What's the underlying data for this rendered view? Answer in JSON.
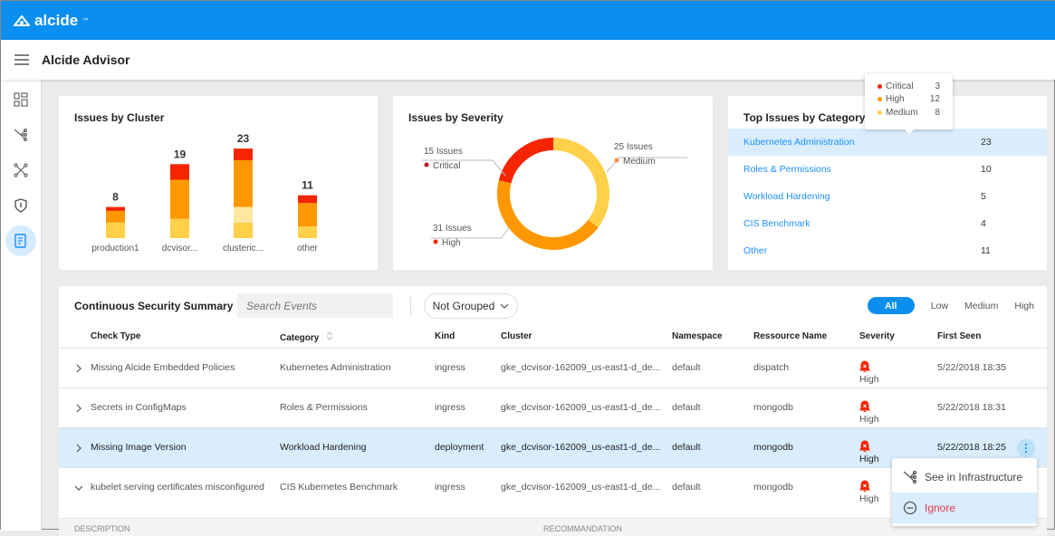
{
  "app": {
    "logo": "alcide",
    "logo_tm": "™",
    "title": "Alcide Advisor"
  },
  "sidebar": {
    "items": [
      {
        "icon": "dashboard-icon"
      },
      {
        "icon": "infrastructure-icon"
      },
      {
        "icon": "network-icon"
      },
      {
        "icon": "shield-icon"
      },
      {
        "icon": "report-icon",
        "active": true
      }
    ]
  },
  "colors": {
    "brand": "#0a8ff0",
    "critical": "#f52500",
    "high": "#ff9800",
    "medium": "#ffd04a",
    "low": "#ffe79f",
    "link": "#1e90ff"
  },
  "chart_data": [
    {
      "type": "bar",
      "stacked": true,
      "title": "Issues by Cluster",
      "categories": [
        "production1",
        "dcvisor...",
        "clusteric...",
        "other"
      ],
      "totals": [
        8,
        19,
        23,
        11
      ],
      "series": [
        {
          "key": "medium",
          "values": [
            4,
            5,
            4,
            3
          ]
        },
        {
          "key": "low",
          "values": [
            0,
            0,
            4,
            0
          ]
        },
        {
          "key": "high",
          "values": [
            3,
            10,
            12,
            6
          ]
        },
        {
          "key": "critical",
          "values": [
            1,
            4,
            3,
            2
          ]
        }
      ]
    },
    {
      "type": "pie",
      "donut": true,
      "title": "Issues by Severity",
      "slices": [
        {
          "label": "Critical",
          "value": 15,
          "text": "15 Issues"
        },
        {
          "label": "Medium",
          "value": 25,
          "text": "25 Issues"
        },
        {
          "label": "High",
          "value": 31,
          "text": "31 Issues"
        }
      ]
    }
  ],
  "categories": {
    "title": "Top Issues by Category",
    "rows": [
      {
        "name": "Kubernetes Administration",
        "count": "23"
      },
      {
        "name": "Roles & Permissions",
        "count": "10"
      },
      {
        "name": "Workload Hardening",
        "count": "5"
      },
      {
        "name": "CIS Benchmark",
        "count": "4"
      },
      {
        "name": "Other",
        "count": "11"
      }
    ],
    "tooltip": [
      {
        "label": "Critical",
        "value": "3"
      },
      {
        "label": "High",
        "value": "12"
      },
      {
        "label": "Medium",
        "value": "8"
      }
    ]
  },
  "summary": {
    "title": "Continuous Security Summary",
    "search_placeholder": "Search Events",
    "group": "Not Grouped",
    "filters": [
      "All",
      "Low",
      "Medium",
      "High"
    ],
    "active_filter": "All",
    "columns": [
      "Check Type",
      "Category",
      "Kind",
      "Cluster",
      "Namespace",
      "Ressource Name",
      "Severity",
      "First Seen"
    ],
    "rows": [
      {
        "check": "Missing Alcide Embedded Policies",
        "category": "Kubernetes Administration",
        "kind": "ingress",
        "cluster": "gke_dcvisor-162009_us-east1-d_de...",
        "namespace": "default",
        "resource": "dispatch",
        "severity": "High",
        "first_seen": "5/22/2018 18:35"
      },
      {
        "check": "Secrets in ConfigMaps",
        "category": "Roles & Permissions",
        "kind": "ingress",
        "cluster": "gke_dcvisor-162009_us-east1-d_de...",
        "namespace": "default",
        "resource": "mongodb",
        "severity": "High",
        "first_seen": "5/22/2018 18:31"
      },
      {
        "check": "Missing Image Version",
        "category": "Workload Hardening",
        "kind": "deployment",
        "cluster": "gke_dcvisor-162009_us-east1-d_de...",
        "namespace": "default",
        "resource": "mongodb",
        "severity": "High",
        "first_seen": "5/22/2018 18:25",
        "selected": true
      },
      {
        "check": "kubelet serving certificates misconfigured",
        "category": "CIS Kubernetes Benchmark",
        "kind": "ingress",
        "cluster": "gke_dcvisor-162009_us-east1-d_de...",
        "namespace": "default",
        "resource": "mongodb",
        "severity": "High",
        "first_seen": "",
        "expanded": true
      }
    ],
    "detail_headers": [
      "DESCRIPTION",
      "RECOMMANDATION"
    ]
  },
  "context_menu": {
    "items": [
      "See in Infrastructure",
      "Ignore"
    ]
  }
}
